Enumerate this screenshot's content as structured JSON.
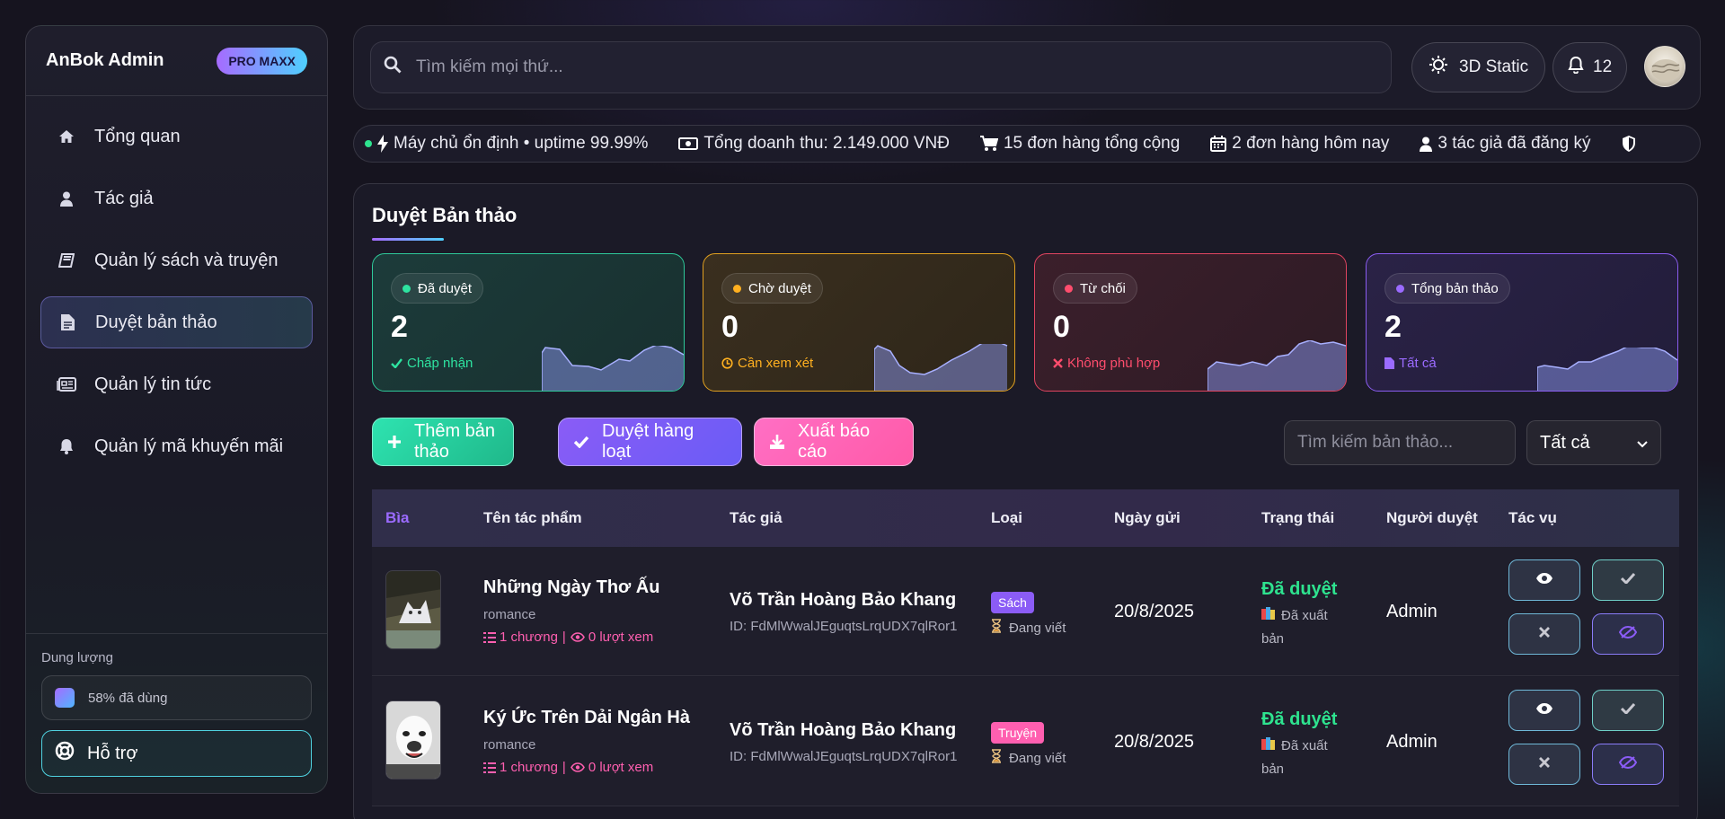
{
  "sidebar": {
    "brand": "AnBok Admin",
    "badge": "PRO MAXX",
    "items": [
      {
        "label": "Tổng quan",
        "icon": "home-icon"
      },
      {
        "label": "Tác giả",
        "icon": "user-icon"
      },
      {
        "label": "Quản lý sách và truyện",
        "icon": "book-icon"
      },
      {
        "label": "Duyệt bản thảo",
        "icon": "file-icon",
        "active": true
      },
      {
        "label": "Quản lý tin tức",
        "icon": "newspaper-icon"
      },
      {
        "label": "Quản lý mã khuyến mãi",
        "icon": "bell-icon"
      }
    ],
    "storage_label": "Dung lượng",
    "storage_value": "58% đã dùng",
    "storage_used": 0.58,
    "support_label": "Hỗ trợ"
  },
  "topbar": {
    "search_placeholder": "Tìm kiếm mọi thứ...",
    "theme_label": "3D Static",
    "notif_count": "12"
  },
  "ticker": [
    {
      "icon": "bolt-icon",
      "text": "Máy chủ ổn định • uptime 99.99%"
    },
    {
      "icon": "money-icon",
      "text": "Tổng doanh thu: 2.149.000 VNĐ"
    },
    {
      "icon": "cart-icon",
      "text": "15 đơn hàng tổng cộng"
    },
    {
      "icon": "calendar-icon",
      "text": "2 đơn hàng hôm nay"
    },
    {
      "icon": "user-icon",
      "text": "3 tác giả đã đăng ký"
    },
    {
      "icon": "shield-icon",
      "text": ""
    }
  ],
  "main": {
    "title": "Duyệt Bản thảo",
    "cards": [
      {
        "chip": "Đã duyệt",
        "value": "2",
        "sub": "Chấp nhận",
        "color": "#2ee3a0"
      },
      {
        "chip": "Chờ duyệt",
        "value": "0",
        "sub": "Cần xem xét",
        "color": "#ffb020"
      },
      {
        "chip": "Từ chối",
        "value": "0",
        "sub": "Không phù hợp",
        "color": "#ff4d6d"
      },
      {
        "chip": "Tổng bản thảo",
        "value": "2",
        "sub": "Tất cả",
        "color": "#9b6bff"
      }
    ],
    "buttons": {
      "add": "Thêm bản thảo",
      "bulk": "Duyệt hàng loạt",
      "export": "Xuất báo cáo"
    },
    "filter_placeholder": "Tìm kiếm bản thảo...",
    "filter_select": "Tất cả",
    "columns": [
      "Bìa",
      "Tên tác phẩm",
      "Tác giả",
      "Loại",
      "Ngày gửi",
      "Trạng thái",
      "Người duyệt",
      "Tác vụ"
    ],
    "rows": [
      {
        "title": "Những Ngày Thơ Ấu",
        "genre": "romance",
        "chapters": "1 chương",
        "views": "0 lượt xem",
        "sep": "|",
        "author": "Võ Trần Hoàng Bảo Khang",
        "author_id": "ID: FdMlWwalJEguqtsLrqUDX7qlRor1",
        "type": "Sách",
        "type_color": "#8b5cf6",
        "writing": "Đang viết",
        "date": "20/8/2025",
        "status": "Đã duyệt",
        "status_sub": "Đã xuất bản",
        "reviewer": "Admin"
      },
      {
        "title": "Ký Ức Trên Dải Ngân Hà",
        "genre": "romance",
        "chapters": "1 chương",
        "views": "0 lượt xem",
        "sep": "|",
        "author": "Võ Trần Hoàng Bảo Khang",
        "author_id": "ID: FdMlWwalJEguqtsLrqUDX7qlRor1",
        "type": "Truyện",
        "type_color": "#ff5fb0",
        "writing": "Đang viết",
        "date": "20/8/2025",
        "status": "Đã duyệt",
        "status_sub": "Đã xuất bản",
        "reviewer": "Admin"
      }
    ]
  }
}
